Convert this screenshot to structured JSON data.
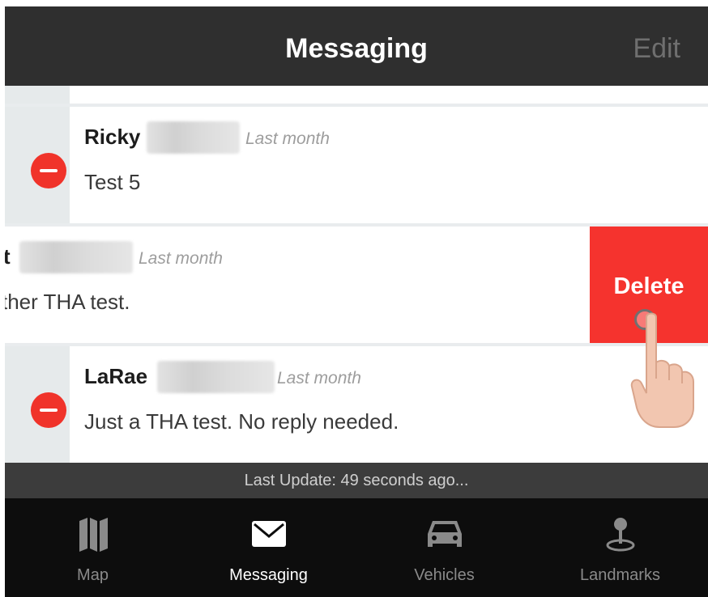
{
  "header": {
    "title": "Messaging",
    "edit_label": "Edit"
  },
  "messages": [
    {
      "name": "Ricky",
      "time": "Last month",
      "preview": "Test 5",
      "name_blurred": true
    },
    {
      "name": "t",
      "time": "Last month",
      "preview": "ther THA test.",
      "name_blurred": true,
      "swiped": true
    },
    {
      "name": "LaRae",
      "time": "Last month",
      "preview": "Just a THA test. No reply needed.",
      "name_blurred": true
    }
  ],
  "swipe_action": {
    "label": "Delete",
    "color": "#f5332e"
  },
  "status": {
    "text": "Last Update: 49 seconds ago..."
  },
  "tabs": [
    {
      "label": "Map",
      "icon": "map-icon",
      "active": false
    },
    {
      "label": "Messaging",
      "icon": "envelope-icon",
      "active": true
    },
    {
      "label": "Vehicles",
      "icon": "car-icon",
      "active": false
    },
    {
      "label": "Landmarks",
      "icon": "landmark-pin-icon",
      "active": false
    }
  ],
  "colors": {
    "header_bg": "#2f2f2f",
    "delete_red": "#f5332e",
    "minus_red": "#f0332a",
    "tabbar_bg": "#0d0d0d"
  }
}
